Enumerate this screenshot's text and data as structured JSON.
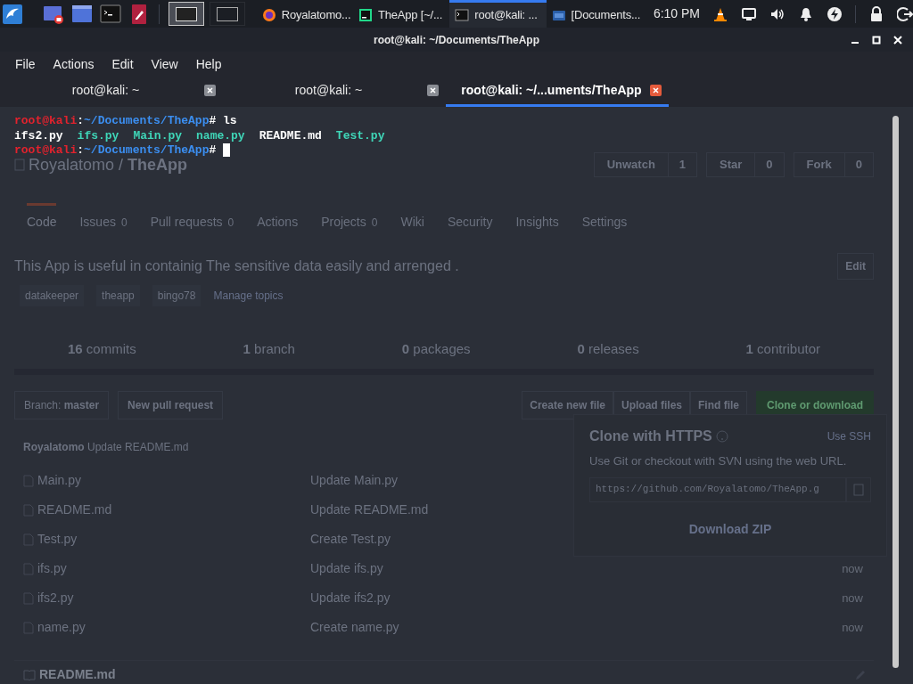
{
  "taskbar": {
    "launchers": [
      {
        "kind": "menu"
      },
      {
        "kind": "recorder"
      },
      {
        "kind": "window"
      },
      {
        "kind": "terminal"
      },
      {
        "kind": "editor"
      }
    ],
    "workspaces": [
      {
        "selected": true
      },
      {
        "selected": false
      }
    ],
    "tasks": [
      {
        "kind": "browser",
        "label": "Royalatomo...",
        "selected": false
      },
      {
        "kind": "ide",
        "label": "TheApp [~/...",
        "selected": false
      },
      {
        "kind": "terminal",
        "label": "root@kali: ...",
        "selected": true
      },
      {
        "kind": "folder",
        "label": "[Documents...",
        "selected": false
      }
    ],
    "clock": "6:10 PM",
    "tray": [
      {
        "kind": "vlc"
      },
      {
        "kind": "display"
      },
      {
        "kind": "volume"
      },
      {
        "kind": "bell"
      },
      {
        "kind": "power"
      },
      {
        "kind": "lock"
      },
      {
        "kind": "logout"
      }
    ]
  },
  "terminal": {
    "title": "root@kali: ~/Documents/TheApp",
    "menu": [
      "File",
      "Actions",
      "Edit",
      "View",
      "Help"
    ],
    "tabs": [
      {
        "label": "root@kali: ~",
        "selected": false
      },
      {
        "label": "root@kali: ~",
        "selected": false
      },
      {
        "label": "root@kali: ~/...uments/TheApp",
        "selected": true
      }
    ],
    "lines": [
      {
        "kind": "prompt",
        "user": "root@kali",
        "separator": ":",
        "path": "~/Documents/TheApp",
        "symbol": "#",
        "command": " ls",
        "cursor": false
      },
      {
        "kind": "listing",
        "files": [
          {
            "name": "ifs2.py",
            "color": "#ffffff"
          },
          {
            "name": "ifs.py",
            "color": "#3fd6b8"
          },
          {
            "name": "Main.py",
            "color": "#3fd6b8"
          },
          {
            "name": "name.py",
            "color": "#3fd6b8"
          },
          {
            "name": "README.md",
            "color": "#ffffff"
          },
          {
            "name": "Test.py",
            "color": "#3fd6b8"
          }
        ]
      },
      {
        "kind": "prompt",
        "user": "root@kali",
        "separator": ":",
        "path": "~/Documents/TheApp",
        "symbol": "#",
        "cursor": true
      }
    ]
  },
  "background_page": {
    "repo_title": "Royalatomo / **TheApp**",
    "repo_buttons": [
      {
        "label": "Unwatch",
        "count": "1"
      },
      {
        "label": "Star",
        "count": "0"
      },
      {
        "label": "Fork",
        "count": "0"
      }
    ],
    "tabs": [
      {
        "label": "Code",
        "selected": true
      },
      {
        "label": "Issues",
        "count": "0",
        "selected": false
      },
      {
        "label": "Pull requests",
        "count": "0",
        "selected": false
      },
      {
        "label": "Actions",
        "selected": false
      },
      {
        "label": "Projects",
        "count": "0",
        "selected": false
      },
      {
        "label": "Wiki",
        "selected": false
      },
      {
        "label": "Security",
        "selected": false
      },
      {
        "label": "Insights",
        "selected": false
      },
      {
        "label": "Settings",
        "selected": false
      }
    ],
    "description": "This App is useful in containig The sensitive data easily and arrenged .",
    "edit_button": "Edit",
    "topics": [
      "datakeeper",
      "theapp",
      "bingo78"
    ],
    "manage_topics": "Manage topics",
    "stats": [
      {
        "count": "16",
        "label": "commits"
      },
      {
        "count": "1",
        "label": "branch"
      },
      {
        "count": "0",
        "label": "packages"
      },
      {
        "count": "0",
        "label": "releases"
      },
      {
        "count": "1",
        "label": "contributor"
      }
    ],
    "branch_label": "Branch:",
    "branch": "master",
    "new_pull_request": "New pull request",
    "file_actions": [
      "Create new file",
      "Upload files",
      "Find file"
    ],
    "clone_button": "Clone or download",
    "last_commit": {
      "author": "Royalatomo",
      "message": "Update README.md"
    },
    "files": [
      {
        "name": "Main.py",
        "message": "Update Main.py"
      },
      {
        "name": "README.md",
        "message": "Update README.md"
      },
      {
        "name": "Test.py",
        "message": "Create Test.py"
      },
      {
        "name": "ifs.py",
        "message": "Update ifs.py",
        "time": "now"
      },
      {
        "name": "ifs2.py",
        "message": "Update ifs2.py",
        "time": "now"
      },
      {
        "name": "name.py",
        "message": "Create name.py",
        "time": "now"
      }
    ],
    "clone_popup": {
      "title": "Clone with HTTPS",
      "switch": "Use SSH",
      "hint": "Use Git or checkout with SVN using the web URL.",
      "url": "https://github.com/Royalatomo/TheApp.g",
      "download": "Download ZIP"
    },
    "readme_title": "README.md"
  }
}
